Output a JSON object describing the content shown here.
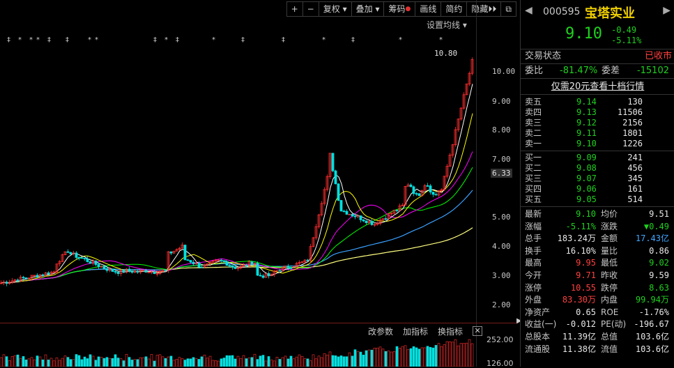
{
  "toolbar": {
    "zoom_in": "+",
    "zoom_out": "−",
    "restore": "复权",
    "overlay": "叠加",
    "chips": "筹码",
    "draw": "画线",
    "brief": "简约",
    "hide": "隐藏",
    "expand": "⏵⏵",
    "popout": "⧉"
  },
  "chart": {
    "ma_settings": "设置均线",
    "y_labels": [
      "10.00",
      "9.00",
      "8.00",
      "7.00",
      "6.33",
      "5.00",
      "4.00",
      "3.00",
      "2.00"
    ],
    "high_marker": "10.80",
    "indicator_tabs": [
      "改参数",
      "加指标",
      "换指标"
    ],
    "indicator_close": "✕",
    "vol_labels": [
      "252.00",
      "126.00"
    ],
    "colors": {
      "up": "#ff3030",
      "down": "#00e0e0",
      "ma5": "#ffffff",
      "ma10": "#ffff00",
      "ma20": "#ff00ff",
      "ma30": "#00ff00",
      "ma60": "#3aa0ff",
      "ma120": "#ffff80"
    }
  },
  "stock": {
    "code": "000595",
    "name": "宝塔实业",
    "price": "9.10",
    "change": "-0.49",
    "change_pct": "-5.11%"
  },
  "status": {
    "label": "交易状态",
    "value": "已收市"
  },
  "ratio": {
    "wb_label": "委比",
    "wb_value": "-81.47%",
    "wc_label": "委差",
    "wc_value": "-15102"
  },
  "promo": "仅需20元查看十档行情",
  "asks": [
    {
      "label": "卖五",
      "price": "9.14",
      "vol": "130"
    },
    {
      "label": "卖四",
      "price": "9.13",
      "vol": "11506"
    },
    {
      "label": "卖三",
      "price": "9.12",
      "vol": "2156"
    },
    {
      "label": "卖二",
      "price": "9.11",
      "vol": "1801"
    },
    {
      "label": "卖一",
      "price": "9.10",
      "vol": "1226"
    }
  ],
  "bids": [
    {
      "label": "买一",
      "price": "9.09",
      "vol": "241"
    },
    {
      "label": "买二",
      "price": "9.08",
      "vol": "456"
    },
    {
      "label": "买三",
      "price": "9.07",
      "vol": "345"
    },
    {
      "label": "买四",
      "price": "9.06",
      "vol": "161"
    },
    {
      "label": "买五",
      "price": "9.05",
      "vol": "514"
    }
  ],
  "stats": [
    {
      "l1": "最新",
      "v1": "9.10",
      "c1": "g",
      "l2": "均价",
      "v2": "9.51",
      "c2": "w"
    },
    {
      "l1": "涨幅",
      "v1": "-5.11%",
      "c1": "g",
      "l2": "涨跌",
      "v2": "▼0.49",
      "c2": "g"
    },
    {
      "l1": "总手",
      "v1": "183.24万",
      "c1": "w",
      "l2": "金额",
      "v2": "17.43亿",
      "c2": "b"
    },
    {
      "l1": "换手",
      "v1": "16.10%",
      "c1": "w",
      "l2": "量比",
      "v2": "0.86",
      "c2": "w"
    },
    {
      "l1": "最高",
      "v1": "9.95",
      "c1": "r",
      "l2": "最低",
      "v2": "9.02",
      "c2": "g"
    },
    {
      "l1": "今开",
      "v1": "9.71",
      "c1": "r",
      "l2": "昨收",
      "v2": "9.59",
      "c2": "w"
    },
    {
      "l1": "涨停",
      "v1": "10.55",
      "c1": "r",
      "l2": "跌停",
      "v2": "8.63",
      "c2": "g"
    },
    {
      "l1": "外盘",
      "v1": "83.30万",
      "c1": "r",
      "l2": "内盘",
      "v2": "99.94万",
      "c2": "g"
    },
    {
      "l1": "净资产",
      "v1": "0.65",
      "c1": "w",
      "l2": "ROE",
      "v2": "-1.76%",
      "c2": "w"
    },
    {
      "l1": "收益(一)",
      "v1": "-0.012",
      "c1": "w",
      "l2": "PE(动)",
      "v2": "-196.67",
      "c2": "w"
    },
    {
      "l1": "总股本",
      "v1": "11.39亿",
      "c1": "w",
      "l2": "总值",
      "v2": "103.6亿",
      "c2": "w"
    },
    {
      "l1": "流通股",
      "v1": "11.38亿",
      "c1": "w",
      "l2": "流值",
      "v2": "103.6亿",
      "c2": "w"
    }
  ]
}
